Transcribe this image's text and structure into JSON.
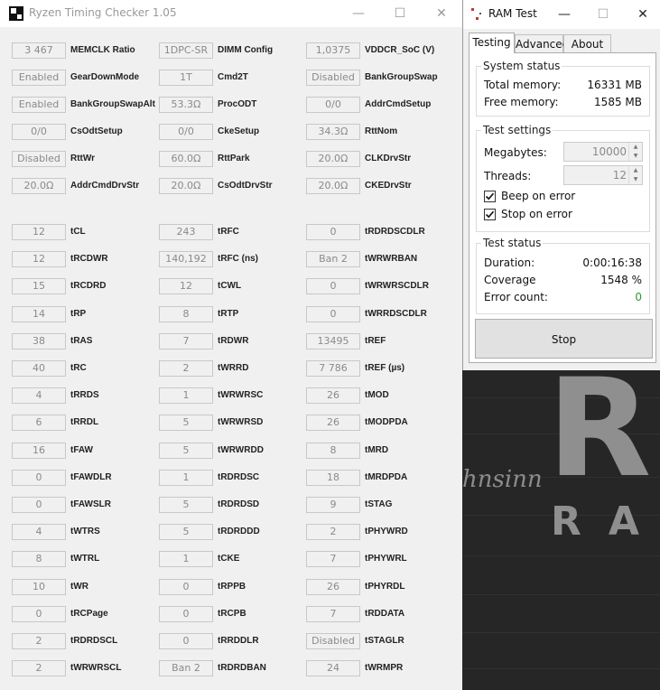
{
  "rtc": {
    "title": "Ryzen Timing Checker 1.05",
    "controls": {
      "minimize": "—",
      "maximize": "☐",
      "close": "✕"
    },
    "top_rows": [
      [
        {
          "v": "3 467",
          "l": "MEMCLK Ratio"
        },
        {
          "v": "1DPC-SR",
          "l": "DIMM Config"
        },
        {
          "v": "1,0375",
          "l": "VDDCR_SoC (V)"
        }
      ],
      [
        {
          "v": "Enabled",
          "l": "GearDownMode"
        },
        {
          "v": "1T",
          "l": "Cmd2T"
        },
        {
          "v": "Disabled",
          "l": "BankGroupSwap"
        }
      ],
      [
        {
          "v": "Enabled",
          "l": "BankGroupSwapAlt"
        },
        {
          "v": "53.3Ω",
          "l": "ProcODT"
        },
        {
          "v": "0/0",
          "l": "AddrCmdSetup"
        }
      ],
      [
        {
          "v": "0/0",
          "l": "CsOdtSetup"
        },
        {
          "v": "0/0",
          "l": "CkeSetup"
        },
        {
          "v": "34.3Ω",
          "l": "RttNom"
        }
      ],
      [
        {
          "v": "Disabled",
          "l": "RttWr"
        },
        {
          "v": "60.0Ω",
          "l": "RttPark"
        },
        {
          "v": "20.0Ω",
          "l": "CLKDrvStr"
        }
      ],
      [
        {
          "v": "20.0Ω",
          "l": "AddrCmdDrvStr"
        },
        {
          "v": "20.0Ω",
          "l": "CsOdtDrvStr"
        },
        {
          "v": "20.0Ω",
          "l": "CKEDrvStr"
        }
      ]
    ],
    "timing_rows": [
      [
        {
          "v": "12",
          "l": "tCL"
        },
        {
          "v": "243",
          "l": "tRFC"
        },
        {
          "v": "0",
          "l": "tRDRDSCDLR"
        }
      ],
      [
        {
          "v": "12",
          "l": "tRCDWR"
        },
        {
          "v": "140,192",
          "l": "tRFC (ns)"
        },
        {
          "v": "Ban 2",
          "l": "tWRWRBAN"
        }
      ],
      [
        {
          "v": "15",
          "l": "tRCDRD"
        },
        {
          "v": "12",
          "l": "tCWL"
        },
        {
          "v": "0",
          "l": "tWRWRSCDLR"
        }
      ],
      [
        {
          "v": "14",
          "l": "tRP"
        },
        {
          "v": "8",
          "l": "tRTP"
        },
        {
          "v": "0",
          "l": "tWRRDSCDLR"
        }
      ],
      [
        {
          "v": "38",
          "l": "tRAS"
        },
        {
          "v": "7",
          "l": "tRDWR"
        },
        {
          "v": "13495",
          "l": "tREF"
        }
      ],
      [
        {
          "v": "40",
          "l": "tRC"
        },
        {
          "v": "2",
          "l": "tWRRD"
        },
        {
          "v": "7 786",
          "l": "tREF (µs)"
        }
      ],
      [
        {
          "v": "4",
          "l": "tRRDS"
        },
        {
          "v": "1",
          "l": "tWRWRSC"
        },
        {
          "v": "26",
          "l": "tMOD"
        }
      ],
      [
        {
          "v": "6",
          "l": "tRRDL"
        },
        {
          "v": "5",
          "l": "tWRWRSD"
        },
        {
          "v": "26",
          "l": "tMODPDA"
        }
      ],
      [
        {
          "v": "16",
          "l": "tFAW"
        },
        {
          "v": "5",
          "l": "tWRWRDD"
        },
        {
          "v": "8",
          "l": "tMRD"
        }
      ],
      [
        {
          "v": "0",
          "l": "tFAWDLR"
        },
        {
          "v": "1",
          "l": "tRDRDSC"
        },
        {
          "v": "18",
          "l": "tMRDPDA"
        }
      ],
      [
        {
          "v": "0",
          "l": "tFAWSLR"
        },
        {
          "v": "5",
          "l": "tRDRDSD"
        },
        {
          "v": "9",
          "l": "tSTAG"
        }
      ],
      [
        {
          "v": "4",
          "l": "tWTRS"
        },
        {
          "v": "5",
          "l": "tRDRDDD"
        },
        {
          "v": "2",
          "l": "tPHYWRD"
        }
      ],
      [
        {
          "v": "8",
          "l": "tWTRL"
        },
        {
          "v": "1",
          "l": "tCKE"
        },
        {
          "v": "7",
          "l": "tPHYWRL"
        }
      ],
      [
        {
          "v": "10",
          "l": "tWR"
        },
        {
          "v": "0",
          "l": "tRPPB"
        },
        {
          "v": "26",
          "l": "tPHYRDL"
        }
      ],
      [
        {
          "v": "0",
          "l": "tRCPage"
        },
        {
          "v": "0",
          "l": "tRCPB"
        },
        {
          "v": "7",
          "l": "tRDDATA"
        }
      ],
      [
        {
          "v": "2",
          "l": "tRDRDSCL"
        },
        {
          "v": "0",
          "l": "tRRDDLR"
        },
        {
          "v": "Disabled",
          "l": "tSTAGLR"
        }
      ],
      [
        {
          "v": "2",
          "l": "tWRWRSCL"
        },
        {
          "v": "Ban 2",
          "l": "tRDRDBAN"
        },
        {
          "v": "24",
          "l": "tWRMPR"
        }
      ]
    ]
  },
  "ramtest": {
    "title": "RAM Test",
    "controls": {
      "minimize": "—",
      "maximize": "☐",
      "close": "✕"
    },
    "tabs": [
      "Testing",
      "Advanced",
      "About"
    ],
    "system_status": {
      "title": "System status",
      "total_label": "Total memory:",
      "total_value": "16331 MB",
      "free_label": "Free memory:",
      "free_value": "1585 MB"
    },
    "test_settings": {
      "title": "Test settings",
      "megabytes_label": "Megabytes:",
      "megabytes_value": "10000",
      "threads_label": "Threads:",
      "threads_value": "12",
      "beep_label": "Beep on error",
      "stop_label": "Stop on error"
    },
    "test_status": {
      "title": "Test status",
      "duration_label": "Duration:",
      "duration_value": "0:00:16:38",
      "coverage_label": "Coverage",
      "coverage_value": "1548 %",
      "errors_label": "Error count:",
      "errors_value": "0"
    },
    "stop_button": "Stop",
    "error_color": "#2a9d2a"
  },
  "background": {
    "script_text": "hnsinn",
    "big_letter": "R",
    "ram_text": "RAM"
  }
}
